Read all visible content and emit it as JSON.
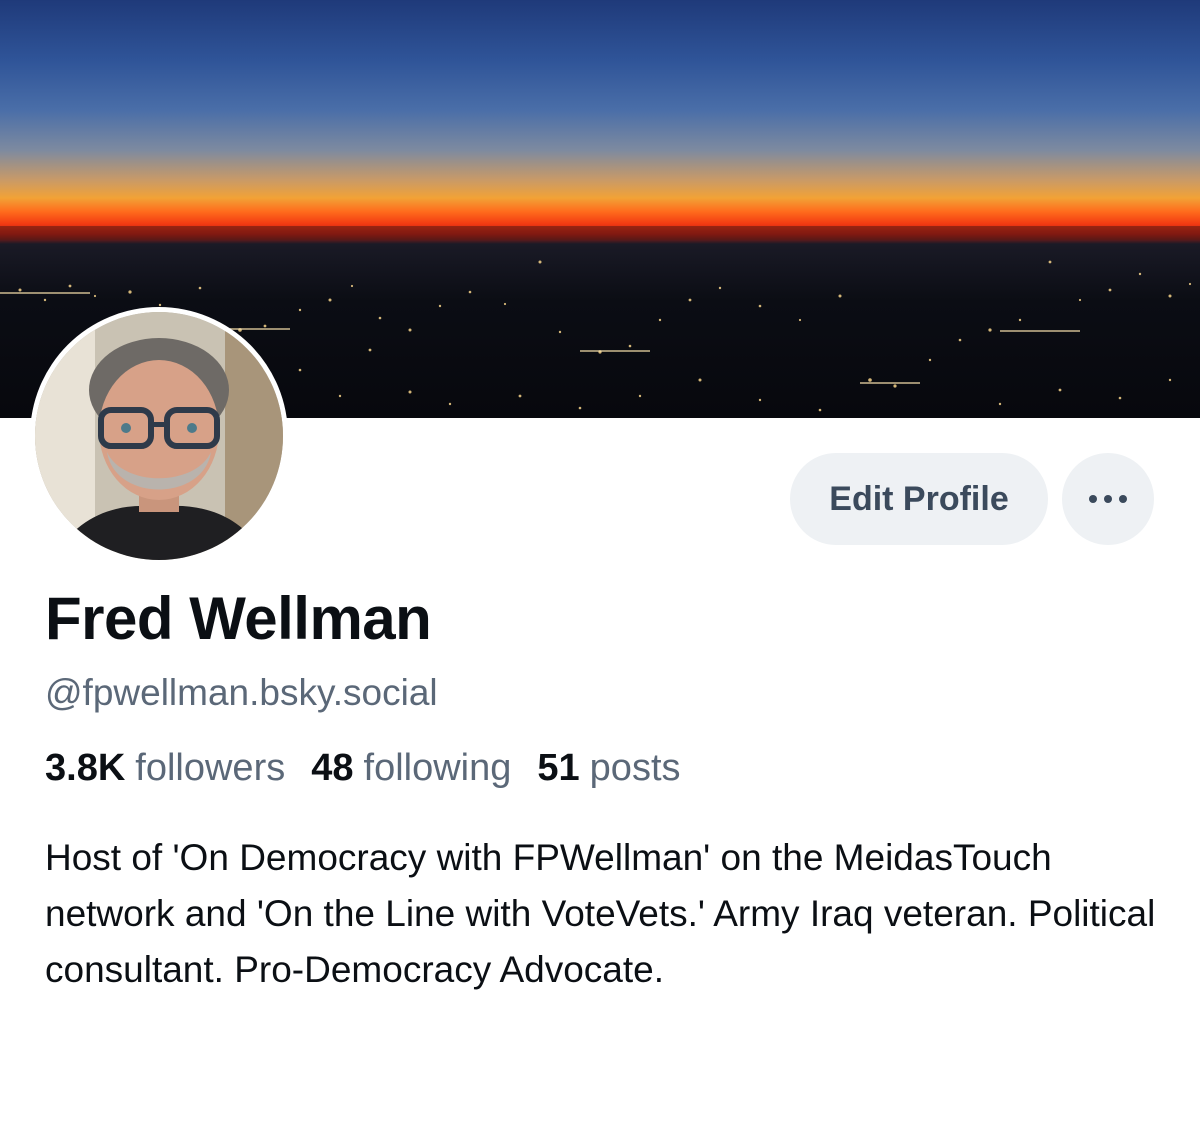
{
  "profile": {
    "display_name": "Fred Wellman",
    "handle": "@fpwellman.bsky.social",
    "bio": "Host of 'On Democracy with FPWellman' on the MeidasTouch network and 'On the Line with VoteVets.' Army Iraq veteran. Political consultant. Pro-Democracy Advocate."
  },
  "stats": {
    "followers_count": "3.8K",
    "followers_label": "followers",
    "following_count": "48",
    "following_label": "following",
    "posts_count": "51",
    "posts_label": "posts"
  },
  "actions": {
    "edit_profile_label": "Edit Profile",
    "more_icon": "ellipsis-icon"
  },
  "colors": {
    "button_bg": "#eef1f4",
    "button_text": "#3b4a5c",
    "secondary_text": "#5b6878",
    "primary_text": "#0b0f14"
  }
}
